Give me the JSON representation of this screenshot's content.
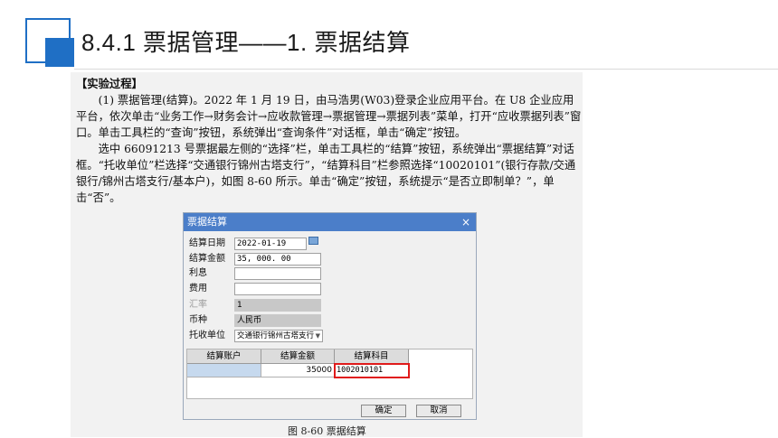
{
  "slide": {
    "title": "8.4.1  票据管理——1. 票据结算",
    "accent_color": "#1f6fc5"
  },
  "document": {
    "heading": "【实验过程】",
    "paragraphs": [
      "(1) 票据管理(结算)。2022 年 1 月 19 日，由马浩男(W03)登录企业应用平台。在 U8 企业应用平台，依次单击“业务工作→财务会计→应收款管理→票据管理→票据列表”菜单，打开“应收票据列表”窗口。单击工具栏的“查询”按钮，系统弹出“查询条件”对话框，单击“确定”按钮。",
      "选中 66091213 号票据最左侧的“选择”栏，单击工具栏的“结算”按钮，系统弹出“票据结算”对话框。“托收单位”栏选择“交通银行锦州古塔支行”，“结算科目”栏参照选择“10020101”(银行存款/交通银行/锦州古塔支行/基本户)，如图 8-60 所示。单击“确定”按钮，系统提示“是否立即制单？”，单击“否”。"
    ],
    "caption": "图 8-60  票据结算"
  },
  "dialog": {
    "title": "票据结算",
    "close": "×",
    "fields": {
      "settle_date_label": "结算日期",
      "settle_date": "2022-01-19",
      "settle_amount_label": "结算金额",
      "settle_amount": "35, 000. 00",
      "interest_label": "利息",
      "interest": "",
      "fee_label": "费用",
      "fee": "",
      "exchange_rate_label": "汇率",
      "exchange_rate": "1",
      "currency_label": "币种",
      "currency": "人民币",
      "collection_unit_label": "托收单位",
      "collection_unit": "交通银行锦州古塔支行"
    },
    "grid": {
      "headers": [
        "结算账户",
        "结算金额",
        "结算科目"
      ],
      "row": [
        "",
        "35000",
        "1002010101"
      ]
    },
    "ok_label": "确定",
    "cancel_label": "取消"
  }
}
